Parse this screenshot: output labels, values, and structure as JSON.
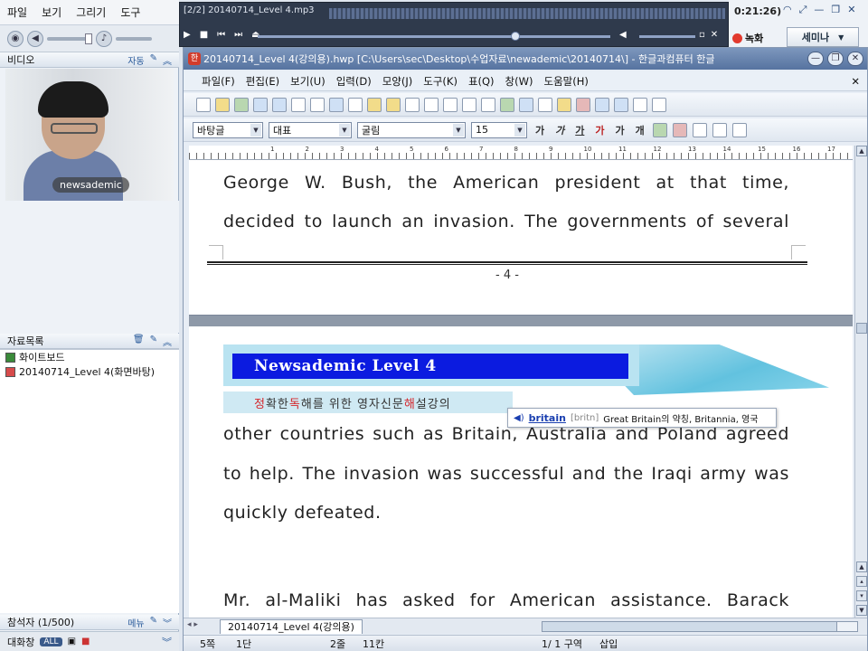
{
  "left_app": {
    "menu": [
      "파일",
      "보기",
      "그리기",
      "도구"
    ],
    "video_panel": {
      "title": "비디오",
      "mode": "자동"
    },
    "video_caption": "newsademic",
    "files_panel": {
      "title": "자료목록",
      "items": [
        "화이트보드",
        "20140714_Level 4(화면바탕)"
      ]
    },
    "participants": {
      "label": "참석자 (1/500)",
      "menu": "메뉴"
    },
    "chat": {
      "label": "대화창",
      "badge": "ALL"
    }
  },
  "player": {
    "title": "[2/2] 20140714_Level 4.mp3",
    "progress": 0.73,
    "volume": 0.95
  },
  "tray": {
    "clock": "0:21:26)",
    "record_label": "녹화",
    "seminar_label": "세미나"
  },
  "hwp": {
    "window_title": "20140714_Level 4(강의용).hwp [C:\\Users\\sec\\Desktop\\수업자료\\newademic\\20140714\\] - 한글과컴퓨터 한글",
    "menu": [
      "파일(F)",
      "편집(E)",
      "보기(U)",
      "입력(D)",
      "모양(J)",
      "도구(K)",
      "표(Q)",
      "창(W)",
      "도움말(H)"
    ],
    "style_combo": "바탕글",
    "lang_combo": "대표",
    "font_combo": "굴림",
    "size_combo": "15",
    "format_buttons": [
      "가",
      "가",
      "가",
      "가",
      "가",
      "개"
    ],
    "ruler_numbers": [
      "1",
      "2",
      "3",
      "4",
      "5",
      "6",
      "7",
      "8",
      "9",
      "10",
      "11",
      "12",
      "13",
      "14",
      "15",
      "16",
      "17"
    ],
    "page1_lines": [
      "George W. Bush, the American president at that time,",
      "decided to launch an invasion. The governments of several"
    ],
    "page_number": "- 4 -",
    "banner_title": "Newsademic Level 4",
    "banner_sub_parts": [
      "정",
      "확한 ",
      "독",
      "해를 위한 영자신문 ",
      "해",
      "설강의"
    ],
    "tooltip": {
      "word": "britain",
      "pron": "[britn]",
      "def": "Great Britain의 약칭, Britannia, 영국"
    },
    "page2_lines": [
      "other countries such as Britain, Australia and Poland agreed",
      "to help. The invasion was successful and the Iraqi army was",
      "quickly defeated.",
      "Mr. al-Maliki has asked for American assistance. Barack"
    ],
    "doc_tab": "20140714_Level 4(강의용)",
    "status": {
      "page": "5쪽",
      "col": "1단",
      "line": "2줄",
      "pos": "11칸",
      "section": "1/ 1 구역",
      "mode": "삽입"
    }
  }
}
